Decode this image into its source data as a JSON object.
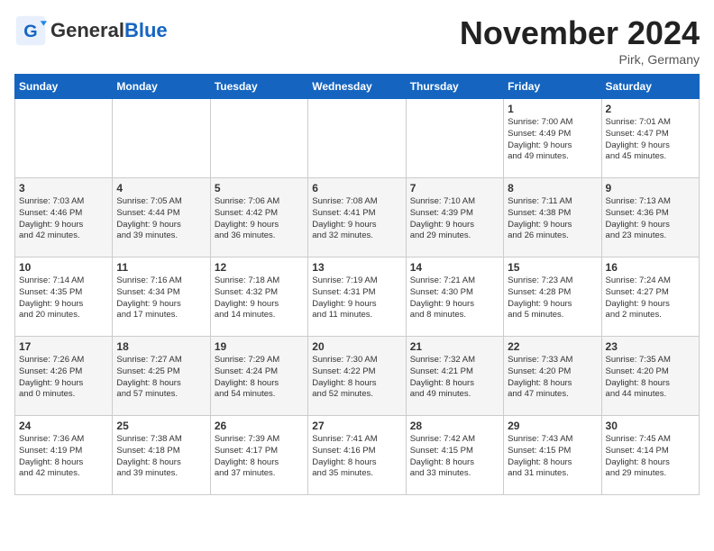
{
  "header": {
    "logo_line1": "General",
    "logo_line2": "Blue",
    "month": "November 2024",
    "location": "Pirk, Germany"
  },
  "weekdays": [
    "Sunday",
    "Monday",
    "Tuesday",
    "Wednesday",
    "Thursday",
    "Friday",
    "Saturday"
  ],
  "weeks": [
    [
      {
        "day": "",
        "info": ""
      },
      {
        "day": "",
        "info": ""
      },
      {
        "day": "",
        "info": ""
      },
      {
        "day": "",
        "info": ""
      },
      {
        "day": "",
        "info": ""
      },
      {
        "day": "1",
        "info": "Sunrise: 7:00 AM\nSunset: 4:49 PM\nDaylight: 9 hours\nand 49 minutes."
      },
      {
        "day": "2",
        "info": "Sunrise: 7:01 AM\nSunset: 4:47 PM\nDaylight: 9 hours\nand 45 minutes."
      }
    ],
    [
      {
        "day": "3",
        "info": "Sunrise: 7:03 AM\nSunset: 4:46 PM\nDaylight: 9 hours\nand 42 minutes."
      },
      {
        "day": "4",
        "info": "Sunrise: 7:05 AM\nSunset: 4:44 PM\nDaylight: 9 hours\nand 39 minutes."
      },
      {
        "day": "5",
        "info": "Sunrise: 7:06 AM\nSunset: 4:42 PM\nDaylight: 9 hours\nand 36 minutes."
      },
      {
        "day": "6",
        "info": "Sunrise: 7:08 AM\nSunset: 4:41 PM\nDaylight: 9 hours\nand 32 minutes."
      },
      {
        "day": "7",
        "info": "Sunrise: 7:10 AM\nSunset: 4:39 PM\nDaylight: 9 hours\nand 29 minutes."
      },
      {
        "day": "8",
        "info": "Sunrise: 7:11 AM\nSunset: 4:38 PM\nDaylight: 9 hours\nand 26 minutes."
      },
      {
        "day": "9",
        "info": "Sunrise: 7:13 AM\nSunset: 4:36 PM\nDaylight: 9 hours\nand 23 minutes."
      }
    ],
    [
      {
        "day": "10",
        "info": "Sunrise: 7:14 AM\nSunset: 4:35 PM\nDaylight: 9 hours\nand 20 minutes."
      },
      {
        "day": "11",
        "info": "Sunrise: 7:16 AM\nSunset: 4:34 PM\nDaylight: 9 hours\nand 17 minutes."
      },
      {
        "day": "12",
        "info": "Sunrise: 7:18 AM\nSunset: 4:32 PM\nDaylight: 9 hours\nand 14 minutes."
      },
      {
        "day": "13",
        "info": "Sunrise: 7:19 AM\nSunset: 4:31 PM\nDaylight: 9 hours\nand 11 minutes."
      },
      {
        "day": "14",
        "info": "Sunrise: 7:21 AM\nSunset: 4:30 PM\nDaylight: 9 hours\nand 8 minutes."
      },
      {
        "day": "15",
        "info": "Sunrise: 7:23 AM\nSunset: 4:28 PM\nDaylight: 9 hours\nand 5 minutes."
      },
      {
        "day": "16",
        "info": "Sunrise: 7:24 AM\nSunset: 4:27 PM\nDaylight: 9 hours\nand 2 minutes."
      }
    ],
    [
      {
        "day": "17",
        "info": "Sunrise: 7:26 AM\nSunset: 4:26 PM\nDaylight: 9 hours\nand 0 minutes."
      },
      {
        "day": "18",
        "info": "Sunrise: 7:27 AM\nSunset: 4:25 PM\nDaylight: 8 hours\nand 57 minutes."
      },
      {
        "day": "19",
        "info": "Sunrise: 7:29 AM\nSunset: 4:24 PM\nDaylight: 8 hours\nand 54 minutes."
      },
      {
        "day": "20",
        "info": "Sunrise: 7:30 AM\nSunset: 4:22 PM\nDaylight: 8 hours\nand 52 minutes."
      },
      {
        "day": "21",
        "info": "Sunrise: 7:32 AM\nSunset: 4:21 PM\nDaylight: 8 hours\nand 49 minutes."
      },
      {
        "day": "22",
        "info": "Sunrise: 7:33 AM\nSunset: 4:20 PM\nDaylight: 8 hours\nand 47 minutes."
      },
      {
        "day": "23",
        "info": "Sunrise: 7:35 AM\nSunset: 4:20 PM\nDaylight: 8 hours\nand 44 minutes."
      }
    ],
    [
      {
        "day": "24",
        "info": "Sunrise: 7:36 AM\nSunset: 4:19 PM\nDaylight: 8 hours\nand 42 minutes."
      },
      {
        "day": "25",
        "info": "Sunrise: 7:38 AM\nSunset: 4:18 PM\nDaylight: 8 hours\nand 39 minutes."
      },
      {
        "day": "26",
        "info": "Sunrise: 7:39 AM\nSunset: 4:17 PM\nDaylight: 8 hours\nand 37 minutes."
      },
      {
        "day": "27",
        "info": "Sunrise: 7:41 AM\nSunset: 4:16 PM\nDaylight: 8 hours\nand 35 minutes."
      },
      {
        "day": "28",
        "info": "Sunrise: 7:42 AM\nSunset: 4:15 PM\nDaylight: 8 hours\nand 33 minutes."
      },
      {
        "day": "29",
        "info": "Sunrise: 7:43 AM\nSunset: 4:15 PM\nDaylight: 8 hours\nand 31 minutes."
      },
      {
        "day": "30",
        "info": "Sunrise: 7:45 AM\nSunset: 4:14 PM\nDaylight: 8 hours\nand 29 minutes."
      }
    ]
  ]
}
